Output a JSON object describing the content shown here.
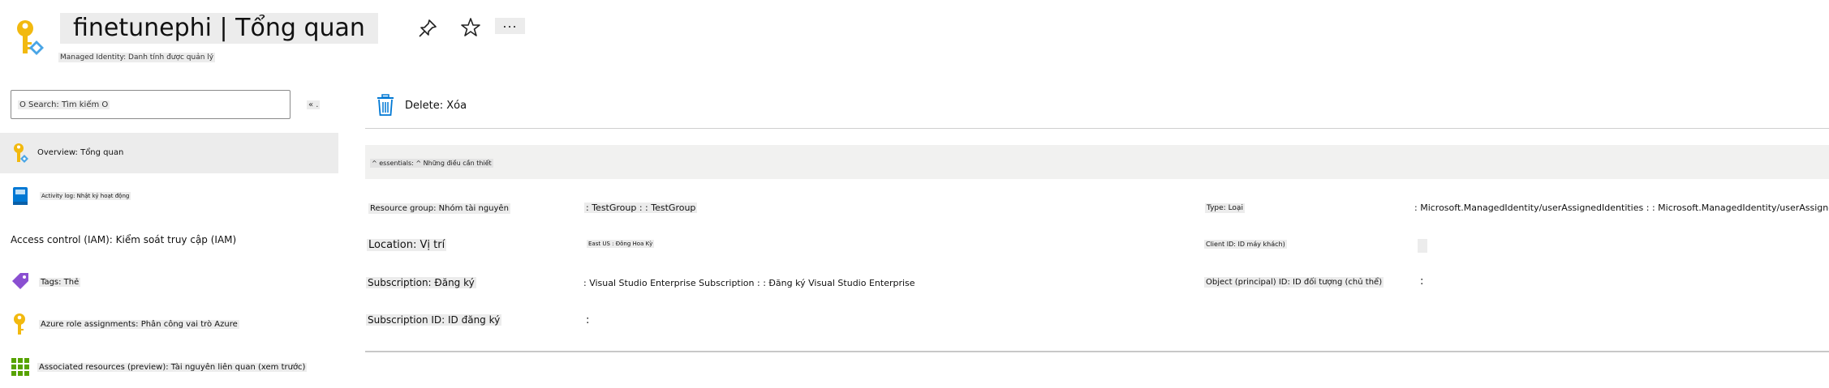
{
  "header": {
    "title": "finetunephi | Tổng quan",
    "subtitle": "Managed Identity: Danh tính được quản lý",
    "more_label": "...",
    "pin_icon": "pin-icon",
    "star_icon": "star-icon",
    "resource_icon": "managed-identity-key-icon"
  },
  "sidebar": {
    "search_text": "O Search: Tìm kiếm O",
    "collapse_label": "« .",
    "items": [
      {
        "label": "Overview: Tổng quan",
        "icon": "key-icon"
      },
      {
        "label": "Activity log: Nhật ký hoạt động",
        "icon": "book-icon"
      },
      {
        "label": "Access control (IAM): Kiểm soát truy cập (IAM)",
        "icon": ""
      },
      {
        "label": "Tags: Thẻ",
        "icon": "tag-icon"
      },
      {
        "label": "Azure role assignments: Phân công vai trò Azure",
        "icon": "key-icon"
      },
      {
        "label": "Associated resources (preview): Tài nguyên liên quan (xem trước)",
        "icon": "grid-icon"
      }
    ]
  },
  "toolbar": {
    "delete_label": "Delete: Xóa",
    "delete_icon": "trash-icon"
  },
  "essentials": {
    "label": "^ essentials: ^ Những điều cần thiết"
  },
  "properties": {
    "resource_group_label": "Resource group: Nhóm tài nguyên",
    "resource_group_value": ": TestGroup : : TestGroup",
    "location_label": "Location: Vị trí",
    "location_value": "East US : Đông Hoa Kỳ",
    "subscription_label": "Subscription: Đăng ký",
    "subscription_value": ": Visual Studio Enterprise Subscription : : Đăng ký Visual Studio Enterprise",
    "subscription_id_label": "Subscription ID: ID đăng ký",
    "subscription_id_value": ":",
    "type_label": "Type: Loại",
    "type_value": ": Microsoft.ManagedIdentity/userAssignedIdentities : : Microsoft.ManagedIdentity/userAssignedIdentities",
    "client_id_label": "Client ID: ID máy khách)",
    "client_id_value": "",
    "object_id_label": "Object (principal) ID: ID đối tượng (chủ thể)",
    "object_id_value": ":"
  },
  "colors": {
    "key_yellow": "#f2b90f",
    "accent_blue": "#0078d4",
    "tag_purple": "#8a4fd1",
    "grid_green": "#57a300"
  }
}
